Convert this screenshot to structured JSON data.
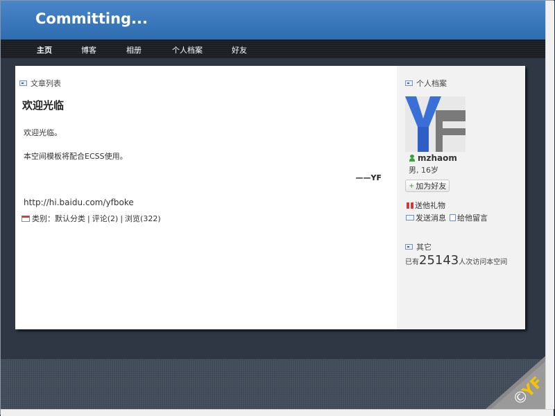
{
  "site": {
    "title": "Committing..."
  },
  "nav": {
    "items": [
      "主页",
      "博客",
      "相册",
      "个人档案",
      "好友"
    ]
  },
  "main": {
    "section_title": "文章列表",
    "post": {
      "title": "欢迎光临",
      "paragraphs": [
        "欢迎光临。",
        "本空间模板将配合ECSS使用。"
      ],
      "signature": "——YF",
      "link": "http://hi.baidu.com/yfboke",
      "category_label": "类别：默认分类",
      "comments": "评论(2)",
      "views": "浏览(322)",
      "sep": "|"
    }
  },
  "sidebar": {
    "profile_title": "个人档案",
    "username": "mzhaom",
    "info": "男, 16岁",
    "add_friend": "加为好友",
    "send_gift": "送他礼物",
    "send_message": "发送消息",
    "leave_message": "给他留言",
    "other_title": "其它",
    "visits_prefix": "已有",
    "visits_count": "25143",
    "visits_suffix": "人次访问本空间",
    "avatar_letters": "YF"
  },
  "corner_logo": {
    "text": "YF",
    "symbol": "©"
  },
  "colors": {
    "header": "#3a7ac0",
    "nav": "#1b1f24",
    "sidebar": "#f2f2f2",
    "page_bg": "#2e3743"
  }
}
